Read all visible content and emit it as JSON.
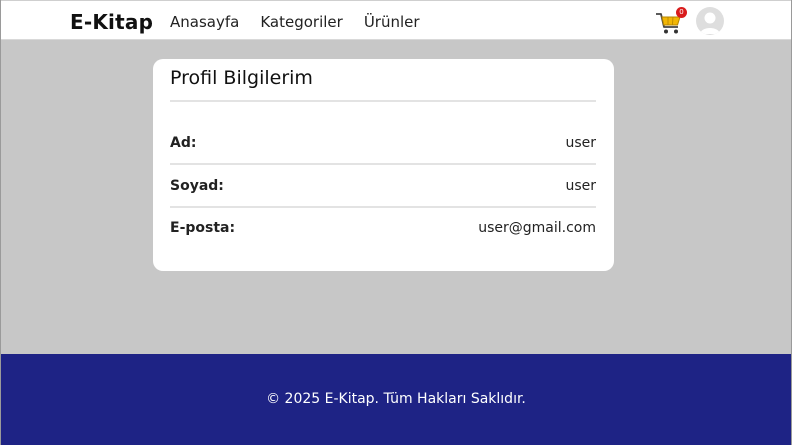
{
  "navbar": {
    "brand": "E-Kitap",
    "links": [
      "Anasayfa",
      "Kategoriler",
      "Ürünler"
    ],
    "cart_icon": "cart-icon",
    "cart_count": "0",
    "avatar_icon": "user-avatar-icon"
  },
  "profile": {
    "title": "Profil Bilgilerim",
    "rows": [
      {
        "label": "Ad:",
        "value": "user"
      },
      {
        "label": "Soyad:",
        "value": "user"
      },
      {
        "label": "E-posta:",
        "value": "user@gmail.com"
      }
    ]
  },
  "footer": {
    "text": "© 2025 E-Kitap. Tüm Hakları Saklıdır."
  },
  "colors": {
    "background": "#c7c7c7",
    "footer": "#1e2385",
    "badge": "#d91c1c",
    "cart": "#f2b705"
  }
}
